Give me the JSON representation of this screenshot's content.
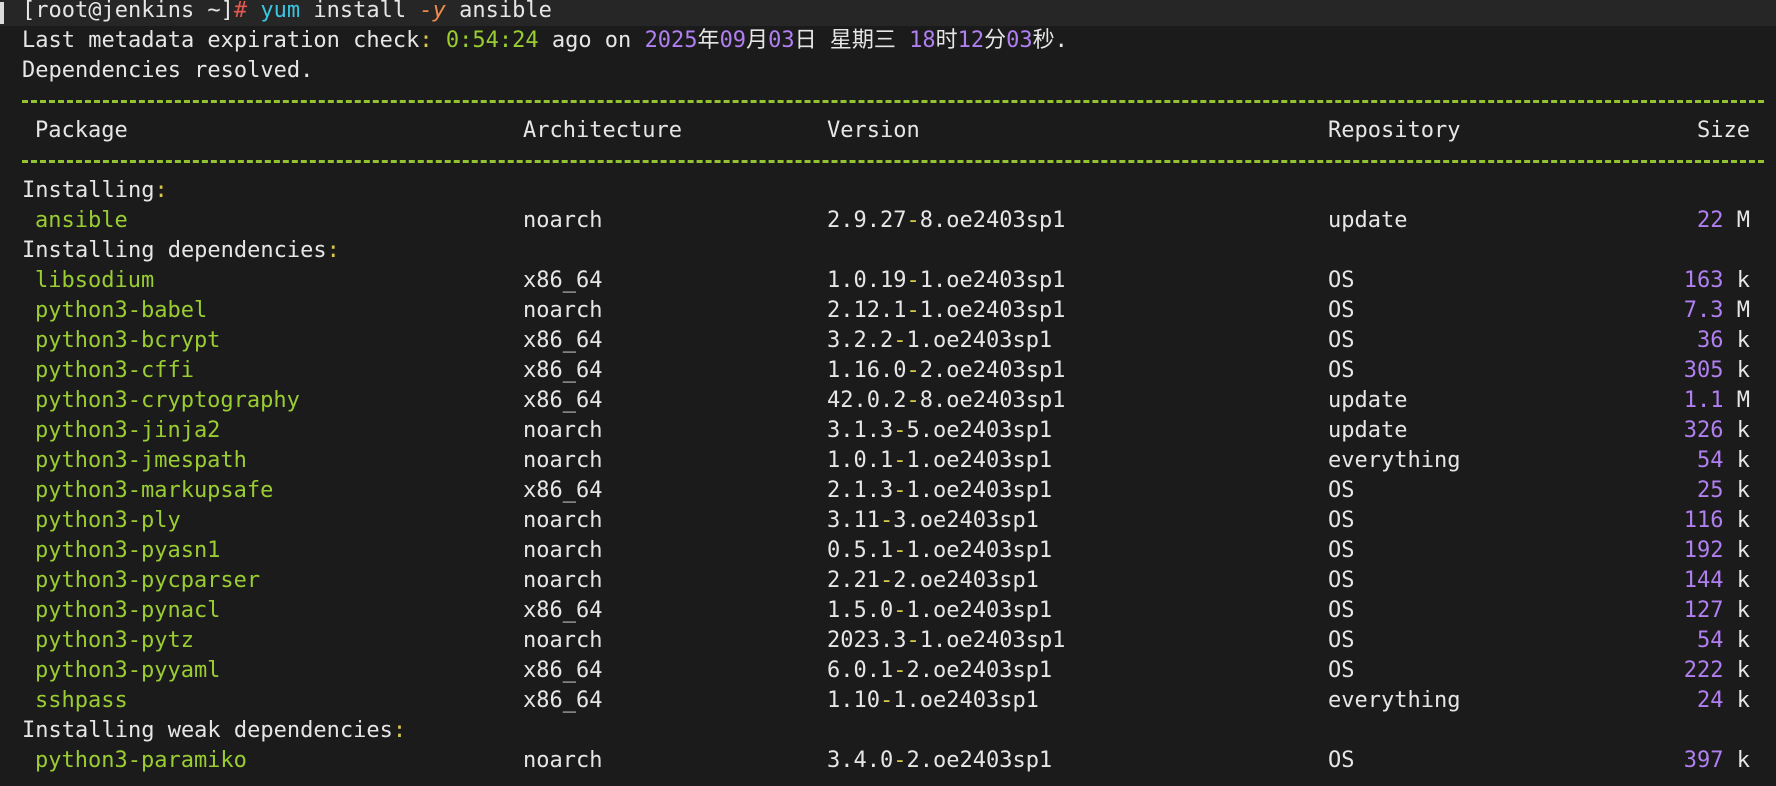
{
  "prompt": {
    "user_host": "[root@jenkins ~]",
    "symbol": "#",
    "cmd": "yum",
    "arg1": "install",
    "flag": "-y",
    "arg2": "ansible"
  },
  "meta": {
    "prefix": "Last metadata expiration check",
    "colon": ":",
    "time": "0:54:24",
    "mid": "ago on",
    "year": "2025",
    "nian": "年",
    "month": "09",
    "yue": "月",
    "day": "03",
    "ri": "日",
    "weekday": "星期三",
    "hour": "18",
    "shi": "时",
    "minute": "12",
    "fen": "分",
    "second": "03",
    "miao": "秒",
    "end": "."
  },
  "resolved": "Dependencies resolved.",
  "separator": "==============================================================================================================================================================================================================",
  "header": {
    "package": "Package",
    "arch": "Architecture",
    "version": "Version",
    "repo": "Repository",
    "size": "Size"
  },
  "sections": {
    "installing": "Installing",
    "deps": "Installing dependencies",
    "weak": "Installing weak dependencies",
    "colon": ":"
  },
  "rows": [
    {
      "pkg": "ansible",
      "arch": "noarch",
      "v1": "2.9.27",
      "v2": "8.oe2403sp1",
      "repo": "update",
      "num": "22",
      "unit": "M"
    },
    {
      "pkg": "libsodium",
      "arch": "x86_64",
      "v1": "1.0.19",
      "v2": "1.oe2403sp1",
      "repo": "OS",
      "num": "163",
      "unit": "k"
    },
    {
      "pkg": "python3-babel",
      "arch": "noarch",
      "v1": "2.12.1",
      "v2": "1.oe2403sp1",
      "repo": "OS",
      "num": "7.3",
      "unit": "M"
    },
    {
      "pkg": "python3-bcrypt",
      "arch": "x86_64",
      "v1": "3.2.2",
      "v2": "1.oe2403sp1",
      "repo": "OS",
      "num": "36",
      "unit": "k"
    },
    {
      "pkg": "python3-cffi",
      "arch": "x86_64",
      "v1": "1.16.0",
      "v2": "2.oe2403sp1",
      "repo": "OS",
      "num": "305",
      "unit": "k"
    },
    {
      "pkg": "python3-cryptography",
      "arch": "x86_64",
      "v1": "42.0.2",
      "v2": "8.oe2403sp1",
      "repo": "update",
      "num": "1.1",
      "unit": "M"
    },
    {
      "pkg": "python3-jinja2",
      "arch": "noarch",
      "v1": "3.1.3",
      "v2": "5.oe2403sp1",
      "repo": "update",
      "num": "326",
      "unit": "k"
    },
    {
      "pkg": "python3-jmespath",
      "arch": "noarch",
      "v1": "1.0.1",
      "v2": "1.oe2403sp1",
      "repo": "everything",
      "num": "54",
      "unit": "k"
    },
    {
      "pkg": "python3-markupsafe",
      "arch": "x86_64",
      "v1": "2.1.3",
      "v2": "1.oe2403sp1",
      "repo": "OS",
      "num": "25",
      "unit": "k"
    },
    {
      "pkg": "python3-ply",
      "arch": "noarch",
      "v1": "3.11",
      "v2": "3.oe2403sp1",
      "repo": "OS",
      "num": "116",
      "unit": "k"
    },
    {
      "pkg": "python3-pyasn1",
      "arch": "noarch",
      "v1": "0.5.1",
      "v2": "1.oe2403sp1",
      "repo": "OS",
      "num": "192",
      "unit": "k"
    },
    {
      "pkg": "python3-pycparser",
      "arch": "noarch",
      "v1": "2.21",
      "v2": "2.oe2403sp1",
      "repo": "OS",
      "num": "144",
      "unit": "k"
    },
    {
      "pkg": "python3-pynacl",
      "arch": "x86_64",
      "v1": "1.5.0",
      "v2": "1.oe2403sp1",
      "repo": "OS",
      "num": "127",
      "unit": "k"
    },
    {
      "pkg": "python3-pytz",
      "arch": "noarch",
      "v1": "2023.3",
      "v2": "1.oe2403sp1",
      "repo": "OS",
      "num": "54",
      "unit": "k"
    },
    {
      "pkg": "python3-pyyaml",
      "arch": "x86_64",
      "v1": "6.0.1",
      "v2": "2.oe2403sp1",
      "repo": "OS",
      "num": "222",
      "unit": "k"
    },
    {
      "pkg": "sshpass",
      "arch": "x86_64",
      "v1": "1.10",
      "v2": "1.oe2403sp1",
      "repo": "everything",
      "num": "24",
      "unit": "k"
    },
    {
      "pkg": "python3-paramiko",
      "arch": "noarch",
      "v1": "3.4.0",
      "v2": "2.oe2403sp1",
      "repo": "OS",
      "num": "397",
      "unit": "k"
    }
  ]
}
